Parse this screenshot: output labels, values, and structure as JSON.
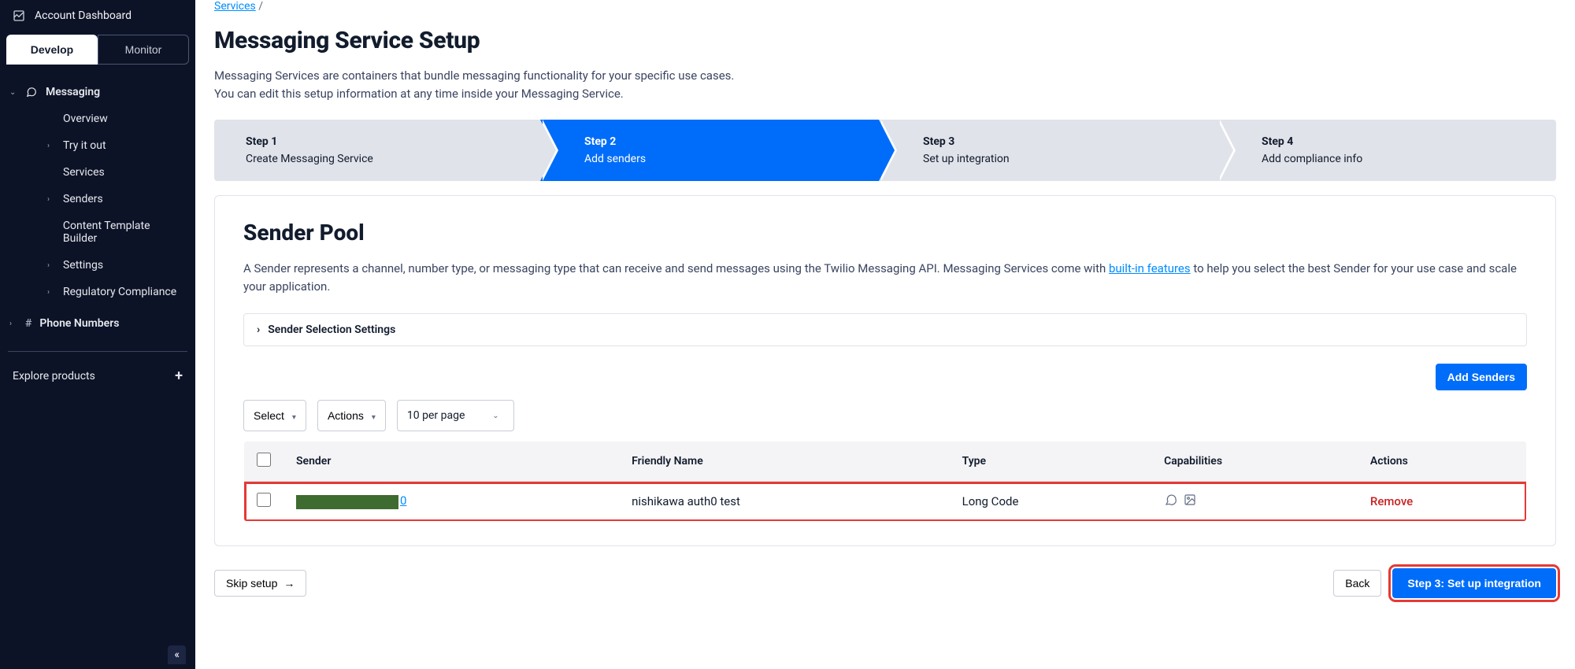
{
  "account_dashboard": "Account Dashboard",
  "tabs": {
    "develop": "Develop",
    "monitor": "Monitor"
  },
  "nav": {
    "messaging": "Messaging",
    "overview": "Overview",
    "try_it_out": "Try it out",
    "services": "Services",
    "senders": "Senders",
    "content_template_builder": "Content Template Builder",
    "settings": "Settings",
    "regulatory_compliance": "Regulatory Compliance",
    "phone_numbers": "Phone Numbers",
    "explore_products": "Explore products"
  },
  "breadcrumb": {
    "services": "Services",
    "sep": "/"
  },
  "page": {
    "title": "Messaging Service Setup",
    "desc1": "Messaging Services are containers that bundle messaging functionality for your specific use cases.",
    "desc2": "You can edit this setup information at any time inside your Messaging Service."
  },
  "steps": [
    {
      "num": "Step 1",
      "txt": "Create Messaging Service"
    },
    {
      "num": "Step 2",
      "txt": "Add senders"
    },
    {
      "num": "Step 3",
      "txt": "Set up integration"
    },
    {
      "num": "Step 4",
      "txt": "Add compliance info"
    }
  ],
  "card": {
    "title": "Sender Pool",
    "desc_pre": "A Sender represents a channel, number type, or messaging type that can receive and send messages using the Twilio Messaging API. Messaging Services come with ",
    "desc_link": "built-in features",
    "desc_post": " to help you select the best Sender for your use case and scale your application.",
    "selection_settings": "Sender Selection Settings",
    "add_senders": "Add Senders"
  },
  "toolbar": {
    "select": "Select",
    "actions": "Actions",
    "per_page": "10 per page"
  },
  "table": {
    "headers": {
      "sender": "Sender",
      "friendly": "Friendly Name",
      "type": "Type",
      "capabilities": "Capabilities",
      "actions": "Actions"
    },
    "rows": [
      {
        "sender_suffix": "0",
        "friendly": "nishikawa auth0 test",
        "type": "Long Code",
        "remove": "Remove"
      }
    ]
  },
  "footer": {
    "skip": "Skip setup",
    "back": "Back",
    "next": "Step 3: Set up integration"
  }
}
